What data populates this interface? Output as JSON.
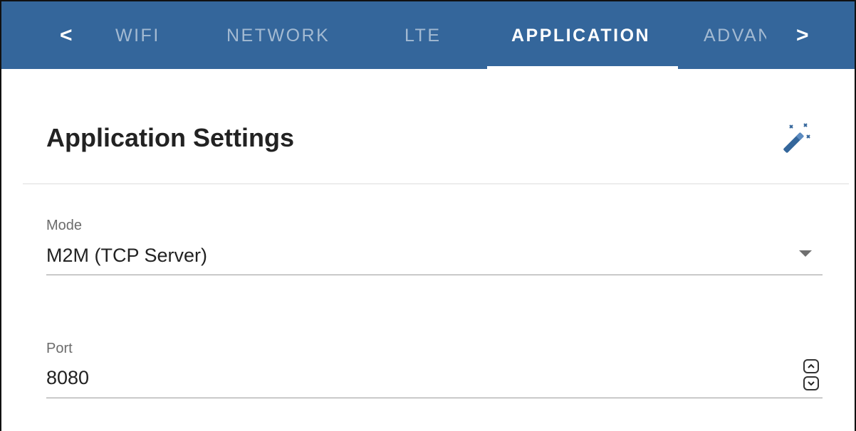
{
  "tabs": {
    "prev_label": "<",
    "next_label": ">",
    "items": [
      {
        "label": "WIFI"
      },
      {
        "label": "NETWORK"
      },
      {
        "label": "LTE"
      },
      {
        "label": "APPLICATION"
      },
      {
        "label": "ADVANCED"
      }
    ],
    "active": "APPLICATION"
  },
  "card": {
    "title": "Application Settings",
    "action_icon": "magic-wand-icon"
  },
  "form": {
    "mode": {
      "label": "Mode",
      "value": "M2M (TCP Server)"
    },
    "port": {
      "label": "Port",
      "value": "8080"
    }
  },
  "colors": {
    "tab_bar": "#34669b",
    "text": "#222222",
    "label": "#6b6b6b"
  }
}
